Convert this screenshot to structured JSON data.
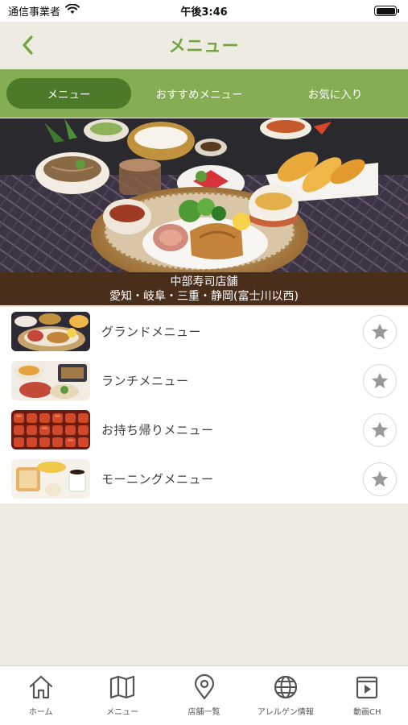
{
  "status_bar": {
    "carrier": "通信事業者",
    "time": "午後3:46"
  },
  "nav": {
    "title": "メニュー",
    "back_icon": "chevron-left-icon"
  },
  "tabs": [
    {
      "label": "メニュー",
      "active": true
    },
    {
      "label": "おすすめメニュー",
      "active": false
    },
    {
      "label": "お気に入り",
      "active": false
    }
  ],
  "hero": {
    "caption_line1": "中部寿司店舗",
    "caption_line2": "愛知・岐阜・三重・静岡(富士川以西)"
  },
  "menu_items": [
    {
      "label": "グランドメニュー",
      "thumb": "set-meal-photo"
    },
    {
      "label": "ランチメニュー",
      "thumb": "lunch-set-photo"
    },
    {
      "label": "お持ち帰りメニュー",
      "thumb": "takeout-sushi-photo"
    },
    {
      "label": "モーニングメニュー",
      "thumb": "toast-breakfast-photo"
    }
  ],
  "bottom_nav": [
    {
      "label": "ホーム",
      "icon": "home-icon"
    },
    {
      "label": "メニュー",
      "icon": "map-book-icon"
    },
    {
      "label": "店舗一覧",
      "icon": "location-pin-icon"
    },
    {
      "label": "アレルゲン情報",
      "icon": "globe-icon"
    },
    {
      "label": "動画CH",
      "icon": "video-icon"
    }
  ],
  "colors": {
    "accent_green": "#72a33f",
    "tab_bar_green": "#84ad54",
    "tab_active": "#4d7a28",
    "caption_brown": "#4a2e1c",
    "background": "#eeebe3"
  }
}
